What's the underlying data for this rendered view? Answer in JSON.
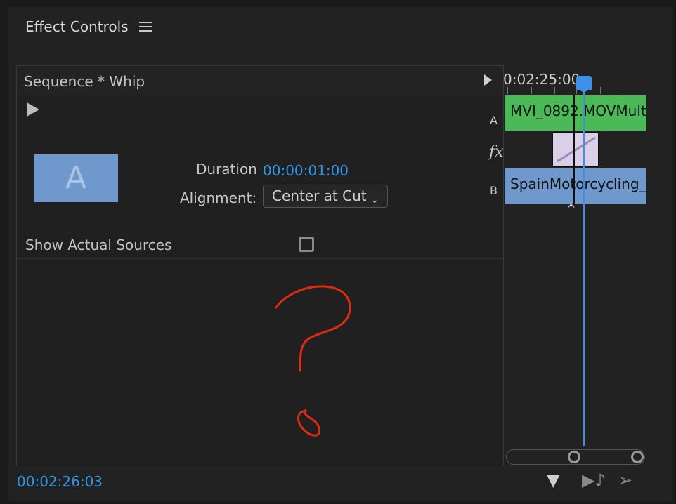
{
  "panel": {
    "title": "Effect Controls",
    "menu_icon": "hamburger-menu-icon"
  },
  "sequence": {
    "title": "Sequence * Whip"
  },
  "transition": {
    "thumb_letter": "A",
    "duration_label": "Duration",
    "duration_value": "00:00:01:00",
    "alignment_label": "Alignment:",
    "alignment_value": "Center at Cut",
    "show_sources_label": "Show Actual Sources",
    "show_sources_checked": false
  },
  "timeline": {
    "time": "0:02:25:00",
    "track_a_label": "A",
    "track_b_label": "B",
    "fx_label": "fx",
    "clip_a_name": "MVI_0892.MOVMult",
    "clip_b_name": "SpainMotorcycling_"
  },
  "footer": {
    "timecode": "00:02:26:03"
  },
  "colors": {
    "accent": "#2f95e8",
    "clip_a": "#4bb957",
    "clip_b": "#6f98cc",
    "scribble": "#e02a12"
  }
}
